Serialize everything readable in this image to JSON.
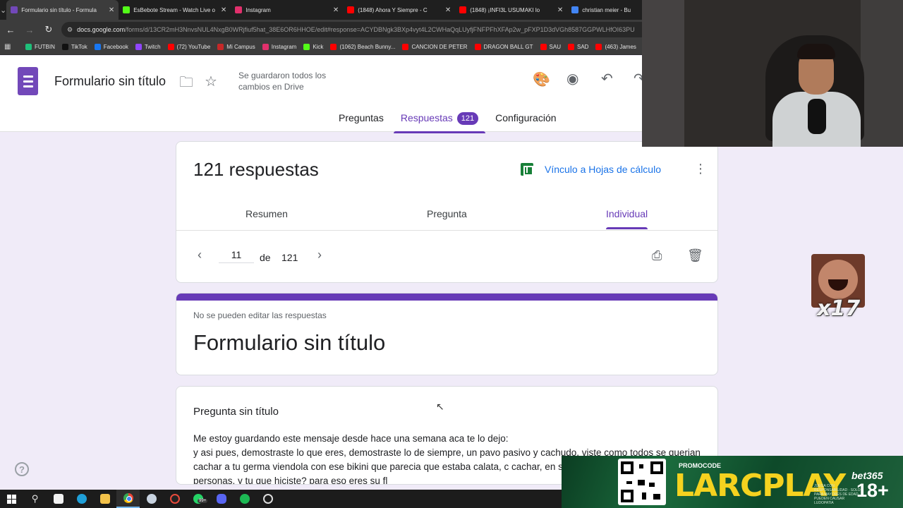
{
  "browser": {
    "tabs": [
      {
        "title": "Formulario sin título - Formula",
        "color": "#7248b9",
        "active": true
      },
      {
        "title": "EsBebote Stream - Watch Live o",
        "color": "#53fc18",
        "active": false
      },
      {
        "title": "Instagram",
        "color": "#e1306c",
        "active": false
      },
      {
        "title": "(1848) Ahora Y Siempre - C",
        "color": "#ff0000",
        "active": false
      },
      {
        "title": "(1848) ¡INFI3L USUMAKI lo",
        "color": "#ff0000",
        "active": false
      },
      {
        "title": "christian meier - Bu",
        "color": "#4285f4",
        "active": false
      }
    ],
    "url_host": "docs.google.com",
    "url_path": "/forms/d/13CR2mH3NnvsNUL4NxgB0WRjfiuf5hat_38E6OR6HHOE/edit#response=ACYDBNgk3BXp4vyt4L2CWHaQqLUyfjFNFPFhXFAp2w_pFXP1D3dVGh8587GGPWLHfOI63PU",
    "bookmarks": [
      {
        "label": "FUTBIN",
        "color": "#1ec07a"
      },
      {
        "label": "TikTok",
        "color": "#111111"
      },
      {
        "label": "Facebook",
        "color": "#1877f2"
      },
      {
        "label": "Twitch",
        "color": "#9146ff"
      },
      {
        "label": "(72) YouTube",
        "color": "#ff0000"
      },
      {
        "label": "Mi Campus",
        "color": "#c62828"
      },
      {
        "label": "Instagram",
        "color": "#e1306c"
      },
      {
        "label": "Kick",
        "color": "#53fc18"
      },
      {
        "label": "(1062) Beach Bunny...",
        "color": "#ff0000"
      },
      {
        "label": "CANCION DE PETER",
        "color": "#ff0000"
      },
      {
        "label": "DRAGON BALL GT",
        "color": "#ff0000"
      },
      {
        "label": "SAU",
        "color": "#ff0000"
      },
      {
        "label": "SAD",
        "color": "#ff0000"
      },
      {
        "label": "(463) James",
        "color": "#ff0000"
      }
    ]
  },
  "form_header": {
    "title": "Formulario sin título",
    "saved_status": "Se guardaron todos los cambios en Drive",
    "tabs": {
      "questions": "Preguntas",
      "responses": "Respuestas",
      "responses_count": "121",
      "settings": "Configuración"
    }
  },
  "summary": {
    "count_title": "121 respuestas",
    "sheets_link": "Vínculo a Hojas de cálculo",
    "subtabs": {
      "summary": "Resumen",
      "question": "Pregunta",
      "individual": "Individual"
    },
    "pager": {
      "current": "11",
      "of": "de",
      "total": "121"
    }
  },
  "response": {
    "no_edit": "No se pueden editar las respuestas",
    "form_title": "Formulario sin título",
    "question_title": "Pregunta sin título",
    "answer": "Me estoy guardando este mensaje desde hace una semana aca te lo dejo:\ny asi pues, demostraste lo que eres, demostraste lo de siempre, un pavo pasivo y cachudo, viste como todos se querian cachar a tu germa viendola con ese bikini que parecia que estaba calata, c cachar, en stream, frente a miles de personas, y tu que hiciste? para eso eres su fl"
  },
  "overlays": {
    "emote_multiplier": "x17",
    "promo_label": "PROMOCODE",
    "promo_code": "LARCPLAY",
    "promo_small": "JUEGA CON RESPONSABILIDAD · SOLO PARA MAYORES DE EDAD · PUEDEN CAUSAR LUDOPATIA",
    "brand": "bet365",
    "age": "18+"
  },
  "taskbar": {
    "badge": "99+"
  },
  "colors": {
    "accent": "#673ab7",
    "link": "#1a73e8",
    "page_bg": "#f0ebf8",
    "sheets": "#188038"
  }
}
